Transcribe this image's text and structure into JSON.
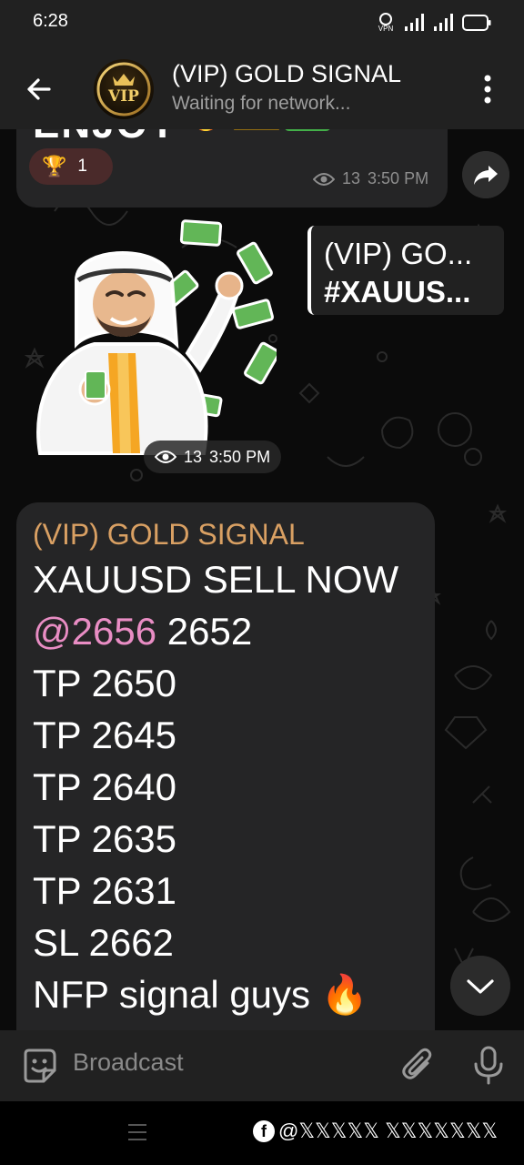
{
  "status_bar": {
    "time": "6:28",
    "vpn_label": "VPN"
  },
  "header": {
    "title": "(VIP) GOLD SIGNAL",
    "subtitle": "Waiting for network...",
    "avatar_text": "VIP"
  },
  "prev_message": {
    "text": "ENJOY",
    "emojis": [
      "fire",
      "crown",
      "check"
    ],
    "reaction": {
      "emoji": "🏆",
      "count": "1"
    },
    "views": "13",
    "time": "3:50 PM"
  },
  "sticker": {
    "views": "13",
    "time": "3:50 PM"
  },
  "reply_preview": {
    "line1": "(VIP) GO...",
    "line2": "#XAUUS..."
  },
  "signal": {
    "author": "(VIP) GOLD SIGNAL",
    "line1": "XAUUSD SELL NOW",
    "mention": "@2656",
    "line2_rest": " 2652",
    "tp1": "TP 2650",
    "tp2": "TP 2645",
    "tp3": "TP 2640",
    "tp4": "TP 2635",
    "tp5": "TP 2631",
    "sl": "SL 2662",
    "footer": "NFP signal guys",
    "footer_emoji": "🔥"
  },
  "input": {
    "placeholder": "Broadcast"
  },
  "watermark": {
    "text": "@𝕏𝕏𝕏𝕏𝕏 𝕏𝕏𝕏𝕏𝕏𝕏𝕏"
  },
  "colors": {
    "accent_author": "#d9a063",
    "mention": "#e98dc4",
    "bubble": "#252526",
    "bars": "#212121"
  }
}
